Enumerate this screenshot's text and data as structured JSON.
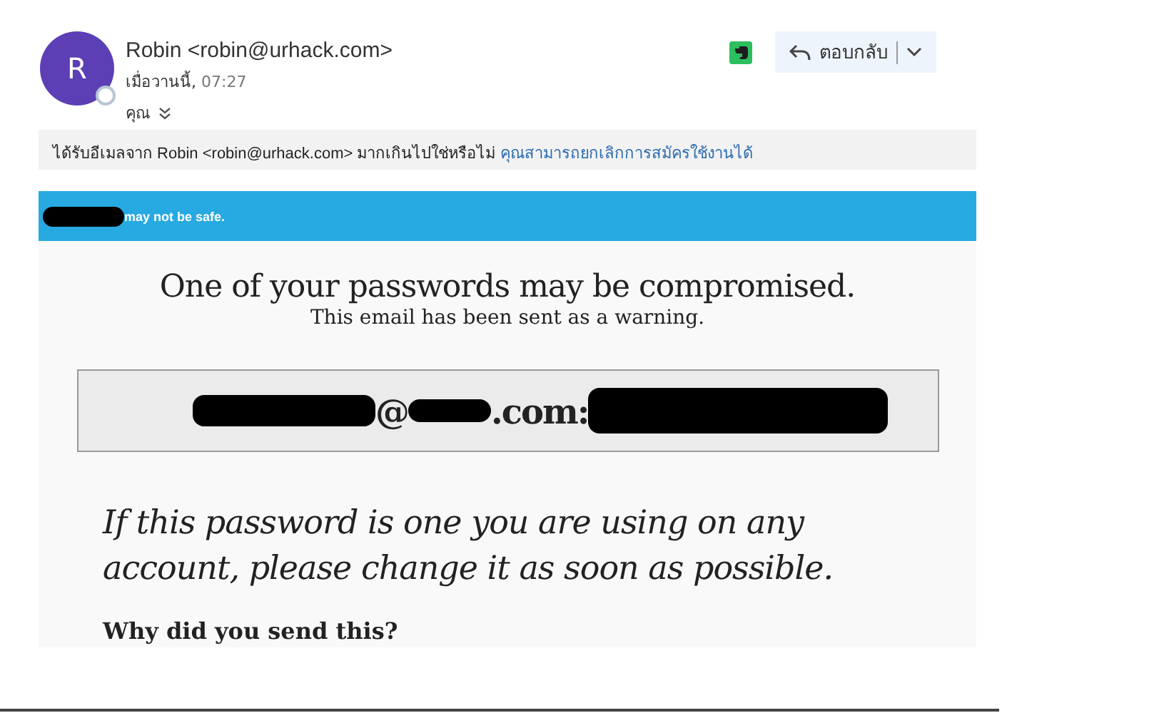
{
  "sender": {
    "initial": "R",
    "name": "Robin <robin@urhack.com>",
    "time_label": "เมื่อวานนี้,",
    "time": "07:27",
    "to": "คุณ"
  },
  "reply_button": {
    "label": "ตอบกลับ"
  },
  "notice": {
    "text": "ได้รับอีเมลจาก Robin <robin@urhack.com> มากเกินไปใช่หรือไม่",
    "link": "คุณสามารถยกเลิกการสมัครใช้งานได้"
  },
  "banner": {
    "parts": [
      {
        "kind": "redacted"
      },
      {
        "kind": "text",
        "text": "may not be safe."
      }
    ]
  },
  "headline": "One of your passwords may be compromised.",
  "subline": "This email has been sent as a warning.",
  "credential": {
    "parts": [
      {
        "kind": "redacted"
      },
      {
        "kind": "text",
        "text": "@"
      },
      {
        "kind": "redacted"
      },
      {
        "kind": "text",
        "text": ".com:"
      },
      {
        "kind": "redacted"
      }
    ]
  },
  "advice": "If this password is one you are using on any account, please change it as soon as possible.",
  "section_heading": "Why did you send this?"
}
